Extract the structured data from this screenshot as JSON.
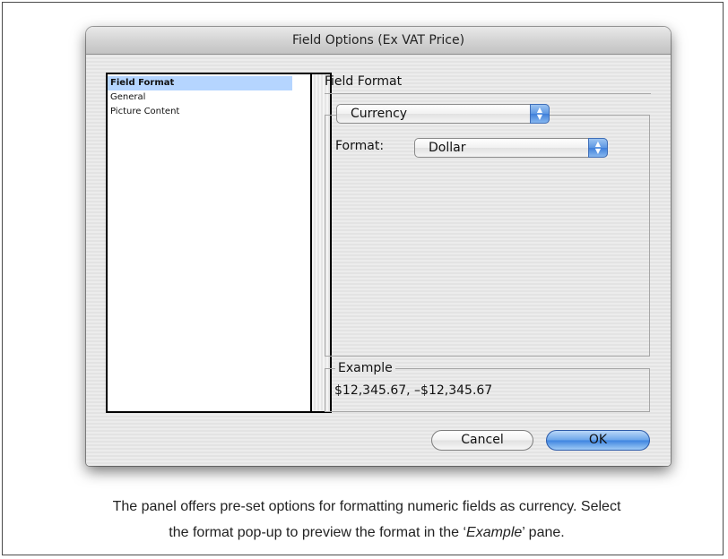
{
  "dialog": {
    "title": "Field Options (Ex VAT Price)",
    "sidebar": {
      "items": [
        {
          "label": "Field Format",
          "selected": true
        },
        {
          "label": "General",
          "selected": false
        },
        {
          "label": "Picture Content",
          "selected": false
        }
      ]
    },
    "section_title": "Field Format",
    "type_popup": {
      "value": "Currency"
    },
    "format": {
      "label": "Format:",
      "value": "Dollar"
    },
    "example": {
      "label": "Example",
      "value": "$12,345.67, –$12,345.67"
    },
    "buttons": {
      "cancel": "Cancel",
      "ok": "OK"
    },
    "colors": {
      "selection": "#b5d5ff",
      "aqua_blue": "#3d84e0"
    },
    "icons": {
      "popup_arrows": "up-down-arrows-icon"
    }
  },
  "caption": {
    "line1": "The panel offers pre-set options for formatting numeric fields as currency. Select",
    "line2_before": "the format pop-up to preview the format in the ‘",
    "line2_em": "Example",
    "line2_after": "’ pane."
  }
}
